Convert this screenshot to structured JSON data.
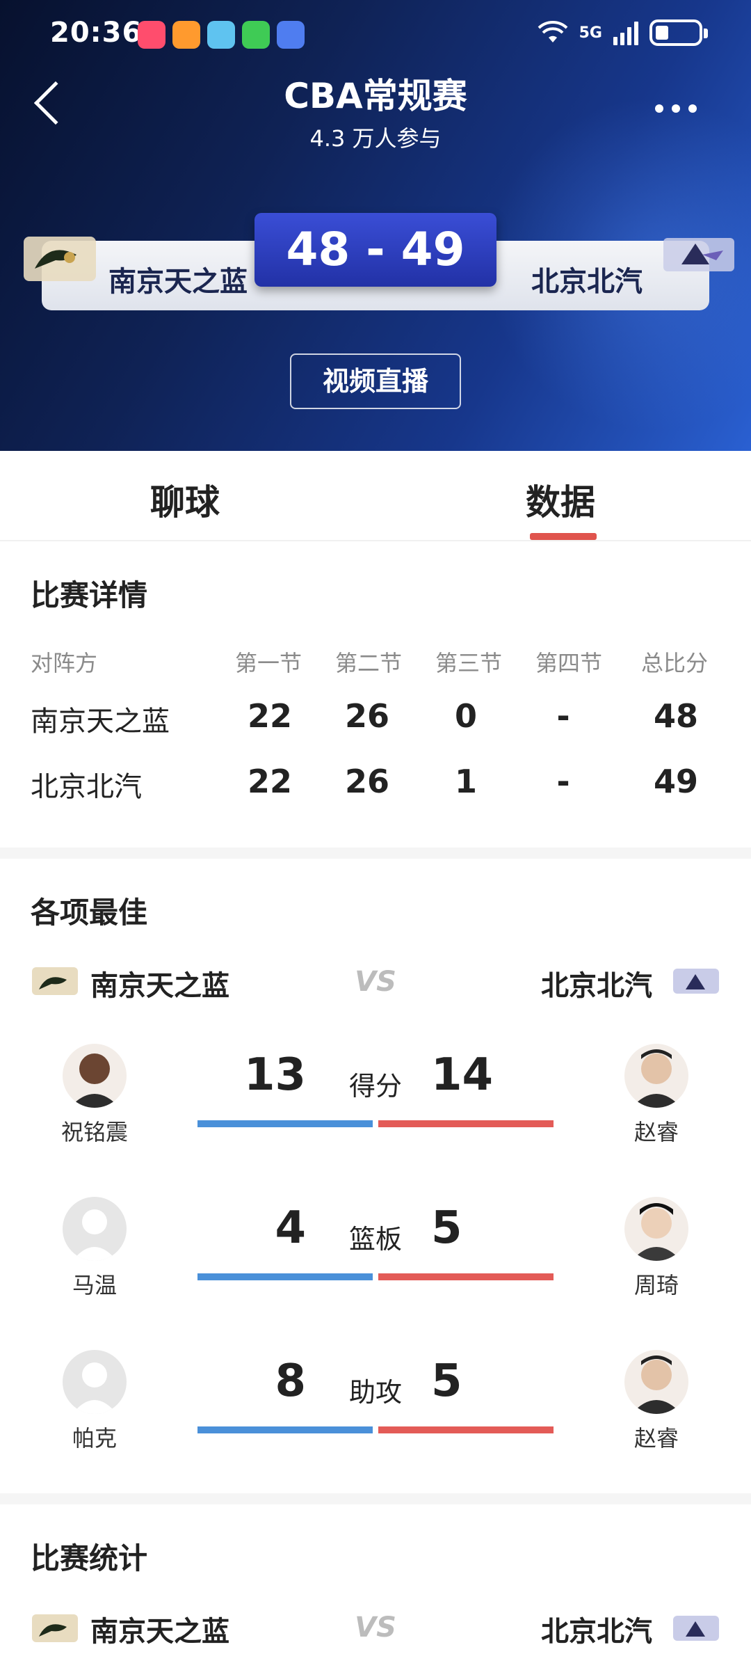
{
  "status_bar": {
    "time": "20:36",
    "network": "5G"
  },
  "header": {
    "title": "CBA常规赛",
    "subtitle": "4.3 万人参与",
    "score": "48 - 49",
    "home_team": "南京天之蓝",
    "away_team": "北京北汽",
    "live_button": "视频直播"
  },
  "tabs": {
    "chat": "聊球",
    "data": "数据",
    "active": "数据"
  },
  "match_detail": {
    "title": "比赛详情",
    "headers": [
      "对阵方",
      "第一节",
      "第二节",
      "第三节",
      "第四节",
      "总比分"
    ],
    "rows": [
      {
        "team": "南京天之蓝",
        "q1": "22",
        "q2": "26",
        "q3": "0",
        "q4": "-",
        "total": "48"
      },
      {
        "team": "北京北汽",
        "q1": "22",
        "q2": "26",
        "q3": "1",
        "q4": "-",
        "total": "49"
      }
    ]
  },
  "best": {
    "title": "各项最佳",
    "home_team": "南京天之蓝",
    "away_team": "北京北汽",
    "vs": "VS",
    "items": [
      {
        "label": "得分",
        "home_value": "13",
        "away_value": "14",
        "home_player": "祝铭震",
        "away_player": "赵睿",
        "home_share": 0.48,
        "away_share": 0.52
      },
      {
        "label": "篮板",
        "home_value": "4",
        "away_value": "5",
        "home_player": "马温",
        "away_player": "周琦",
        "home_share": 0.44,
        "away_share": 0.56
      },
      {
        "label": "助攻",
        "home_value": "8",
        "away_value": "5",
        "home_player": "帕克",
        "away_player": "赵睿",
        "home_share": 0.62,
        "away_share": 0.38
      }
    ]
  },
  "match_stats": {
    "title": "比赛统计",
    "home_team": "南京天之蓝",
    "away_team": "北京北汽",
    "vs": "VS"
  },
  "colors": {
    "home_bar": "#4a90d9",
    "away_bar": "#e35b57",
    "tab_accent": "#e0544d"
  }
}
